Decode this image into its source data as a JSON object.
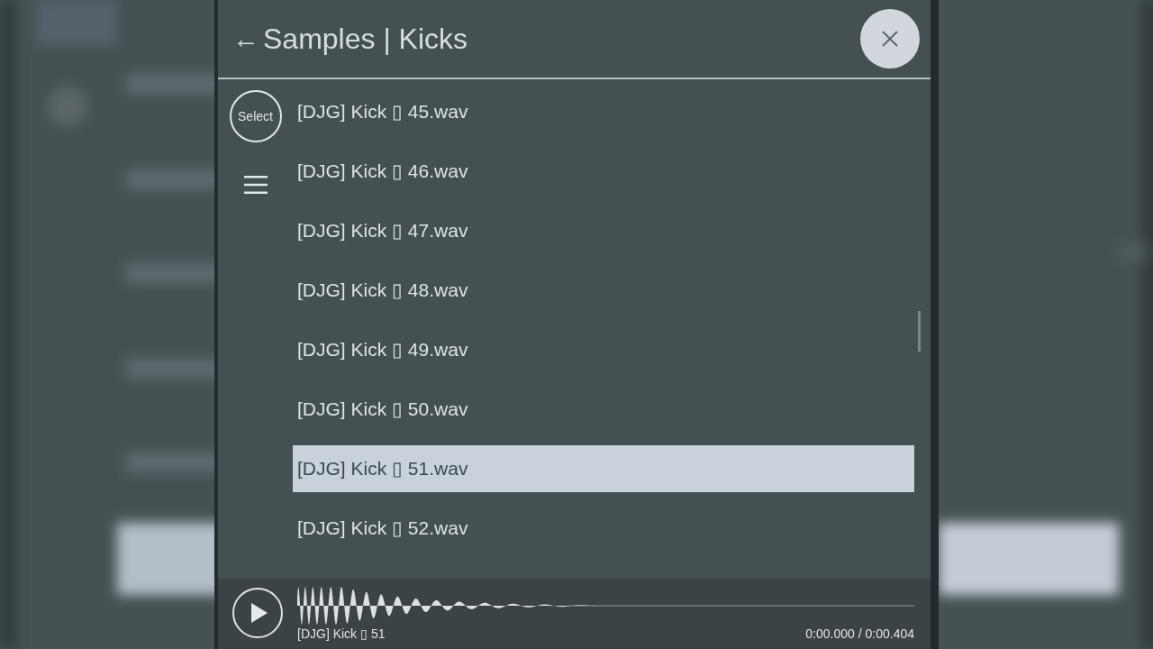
{
  "header": {
    "back": "←",
    "title": "Samples | Kicks"
  },
  "sidebar": {
    "select_button": "Select"
  },
  "files": [
    {
      "name": "[DJG] Kick ▯ 45.wav",
      "selected": false
    },
    {
      "name": "[DJG] Kick ▯ 46.wav",
      "selected": false
    },
    {
      "name": "[DJG] Kick ▯ 47.wav",
      "selected": false
    },
    {
      "name": "[DJG] Kick ▯ 48.wav",
      "selected": false
    },
    {
      "name": "[DJG] Kick ▯ 49.wav",
      "selected": false
    },
    {
      "name": "[DJG] Kick ▯ 50.wav",
      "selected": false
    },
    {
      "name": "[DJG] Kick ▯ 51.wav",
      "selected": true
    },
    {
      "name": "[DJG] Kick ▯ 52.wav",
      "selected": false
    }
  ],
  "player": {
    "track": "[DJG] Kick ▯ 51",
    "time": "0:00.000 / 0:00.404"
  }
}
